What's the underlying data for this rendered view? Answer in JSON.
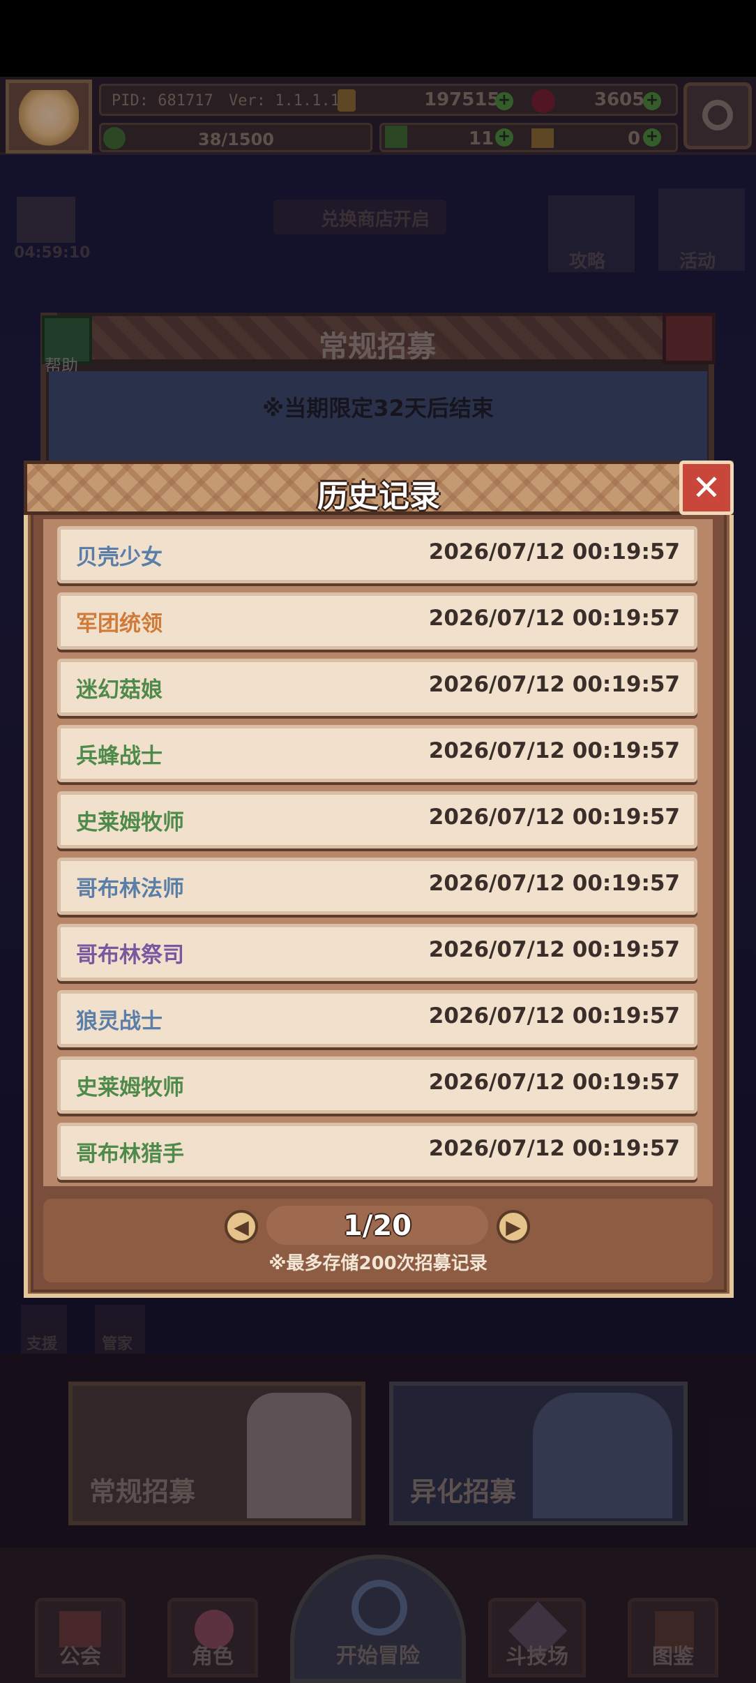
{
  "topbar": {
    "pid": "PID: 681717",
    "version": "Ver: 1.1.1.10",
    "coins": "197515",
    "gems": "3605",
    "stamina": "38/1500",
    "clover": "11",
    "bread": "0"
  },
  "side": {
    "timer": "04:59:10",
    "shop_notice": "兑换商店开启",
    "guide_label": "攻略",
    "event_label": "活动",
    "assist_label": "支援",
    "manager_label": "管家"
  },
  "recruit_panel": {
    "title": "常规招募",
    "help_label": "帮助",
    "notice": "※当期限定32天后结束"
  },
  "history": {
    "title": "历史记录",
    "records": [
      {
        "name": "贝壳少女",
        "time": "2026/07/12 00:19:57",
        "color": "#5a7ea8"
      },
      {
        "name": "军团统领",
        "time": "2026/07/12 00:19:57",
        "color": "#d07a3a"
      },
      {
        "name": "迷幻菇娘",
        "time": "2026/07/12 00:19:57",
        "color": "#4e8a4a"
      },
      {
        "name": "兵蜂战士",
        "time": "2026/07/12 00:19:57",
        "color": "#4e8a4a"
      },
      {
        "name": "史莱姆牧师",
        "time": "2026/07/12 00:19:57",
        "color": "#4e8a4a"
      },
      {
        "name": "哥布林法师",
        "time": "2026/07/12 00:19:57",
        "color": "#5a7ea8"
      },
      {
        "name": "哥布林祭司",
        "time": "2026/07/12 00:19:57",
        "color": "#7a58a0"
      },
      {
        "name": "狼灵战士",
        "time": "2026/07/12 00:19:57",
        "color": "#5a7ea8"
      },
      {
        "name": "史莱姆牧师",
        "time": "2026/07/12 00:19:57",
        "color": "#4e8a4a"
      },
      {
        "name": "哥布林猎手",
        "time": "2026/07/12 00:19:57",
        "color": "#4e8a4a"
      }
    ],
    "page": "1/20",
    "note": "※最多存储200次招募记录"
  },
  "cards": {
    "normal": "常规招募",
    "alt": "异化招募"
  },
  "nav": {
    "guild": "公会",
    "character": "角色",
    "adventure": "开始冒险",
    "arena": "斗技场",
    "codex": "图鉴"
  }
}
